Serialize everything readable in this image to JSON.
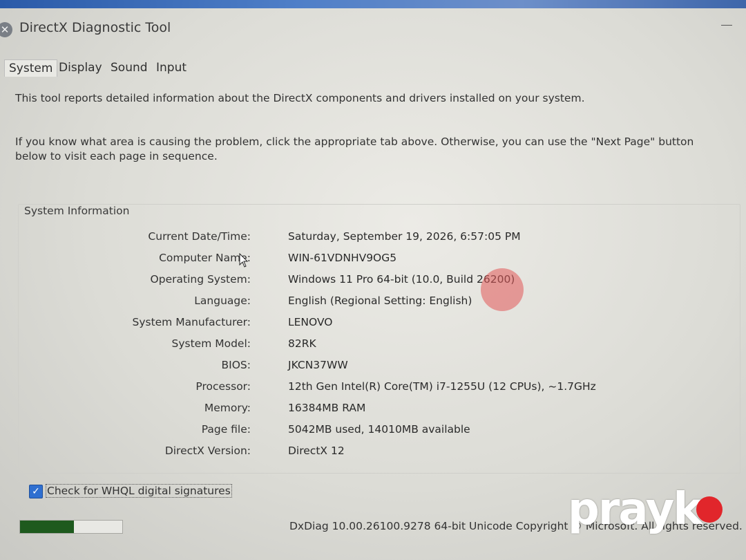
{
  "window": {
    "title": "DirectX Diagnostic Tool"
  },
  "tabs": [
    {
      "label": "System",
      "active": true
    },
    {
      "label": "Display",
      "active": false
    },
    {
      "label": "Sound",
      "active": false
    },
    {
      "label": "Input",
      "active": false
    }
  ],
  "intro": {
    "line1": "This tool reports detailed information about the DirectX components and drivers installed on your system.",
    "line2": "If you know what area is causing the problem, click the appropriate tab above.  Otherwise, you can use the \"Next Page\" button below to visit each page in sequence."
  },
  "system_info": {
    "group_title": "System Information",
    "rows": [
      {
        "label": "Current Date/Time:",
        "value": "Saturday, September 19, 2026, 6:57:05 PM"
      },
      {
        "label": "Computer Name:",
        "value": "WIN-61VDNHV9OG5"
      },
      {
        "label": "Operating System:",
        "value": "Windows 11 Pro 64-bit (10.0, Build 26200)"
      },
      {
        "label": "Language:",
        "value": "English (Regional Setting: English)"
      },
      {
        "label": "System Manufacturer:",
        "value": "LENOVO"
      },
      {
        "label": "System Model:",
        "value": "82RK"
      },
      {
        "label": "BIOS:",
        "value": "JKCN37WW"
      },
      {
        "label": "Processor:",
        "value": "12th Gen Intel(R) Core(TM) i7-1255U (12 CPUs), ~1.7GHz"
      },
      {
        "label": "Memory:",
        "value": "16384MB RAM"
      },
      {
        "label": "Page file:",
        "value": "5042MB used, 14010MB available"
      },
      {
        "label": "DirectX Version:",
        "value": "DirectX 12"
      }
    ]
  },
  "whql": {
    "label": "Check for WHQL digital signatures",
    "checked": true
  },
  "progress": {
    "fraction": 0.53,
    "color": "#1e5a1e"
  },
  "footer": {
    "copyright": "DxDiag 10.00.26100.9278 64-bit Unicode  Copyright © Microsoft. All rights reserved."
  },
  "watermark": {
    "text": "prayk"
  },
  "colors": {
    "accent": "#2f6fd0",
    "record_dot": "#e25858",
    "brand_dot": "#e1262b"
  }
}
